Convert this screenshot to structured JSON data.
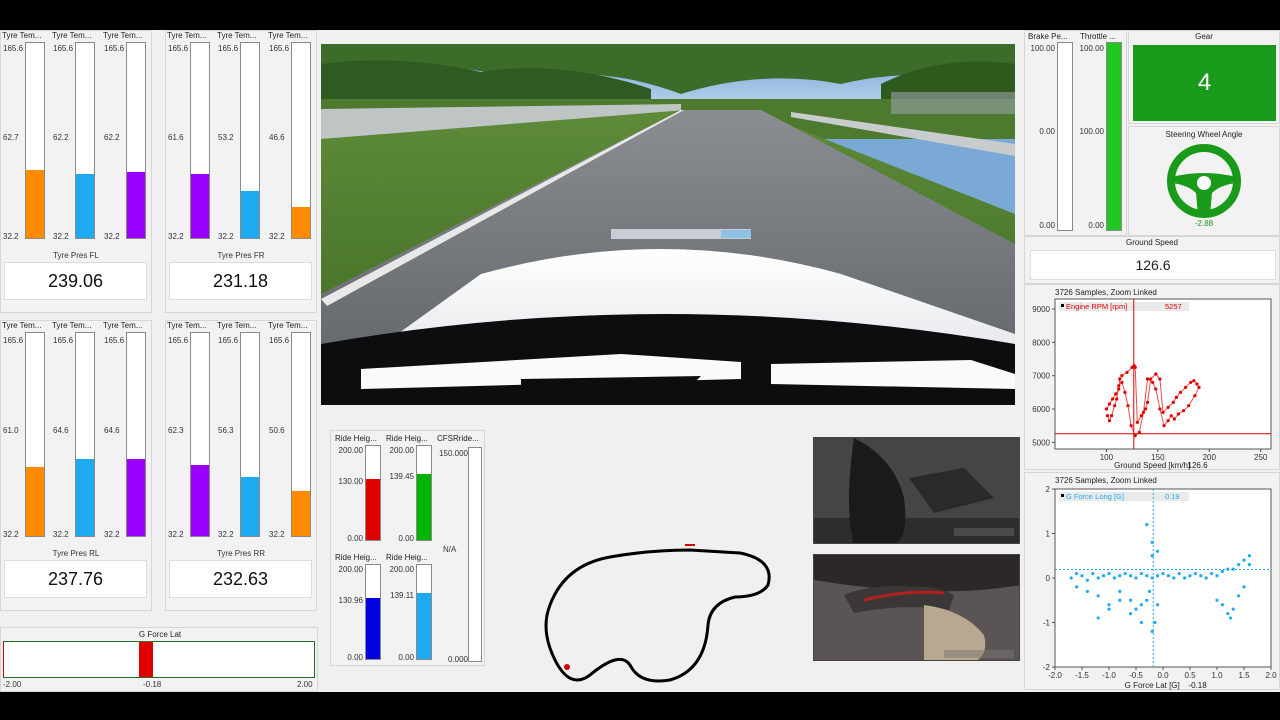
{
  "tyres": {
    "fl": {
      "labels": [
        "Tyre Tem...",
        "Tyre Tem...",
        "Tyre Tem..."
      ],
      "max": "165.6",
      "min": "32.2",
      "mids": [
        "62.7",
        "62.2",
        "62.2"
      ],
      "fills": [
        0.35,
        0.33,
        0.34
      ],
      "colors": [
        "#ff8c00",
        "#1eaaf1",
        "#9b00ff"
      ],
      "pres_label": "Tyre Pres FL",
      "pres_value": "239.06"
    },
    "fr": {
      "labels": [
        "Tyre Tem...",
        "Tyre Tem...",
        "Tyre Tem..."
      ],
      "max": "165.6",
      "min": "32.2",
      "mids": [
        "61.6",
        "53.2",
        "46.6"
      ],
      "fills": [
        0.33,
        0.24,
        0.16
      ],
      "colors": [
        "#9b00ff",
        "#1eaaf1",
        "#ff8c00"
      ],
      "pres_label": "Tyre Pres FR",
      "pres_value": "231.18"
    },
    "rl": {
      "labels": [
        "Tyre Tem...",
        "Tyre Tem...",
        "Tyre Tem..."
      ],
      "max": "165.6",
      "min": "32.2",
      "mids": [
        "61.0",
        "64.6",
        "64.6"
      ],
      "fills": [
        0.34,
        0.38,
        0.38
      ],
      "colors": [
        "#ff8c00",
        "#1eaaf1",
        "#9b00ff"
      ],
      "pres_label": "Tyre Pres RL",
      "pres_value": "237.76"
    },
    "rr": {
      "labels": [
        "Tyre Tem...",
        "Tyre Tem...",
        "Tyre Tem..."
      ],
      "max": "165.6",
      "min": "32.2",
      "mids": [
        "62.3",
        "56.3",
        "50.6"
      ],
      "fills": [
        0.35,
        0.29,
        0.22
      ],
      "colors": [
        "#9b00ff",
        "#1eaaf1",
        "#ff8c00"
      ],
      "pres_label": "Tyre Pres RR",
      "pres_value": "232.63"
    }
  },
  "glat": {
    "label": "G Force Lat",
    "min": "-2.00",
    "max": "2.00",
    "value": "-0.18",
    "fraction": 0.455,
    "color": "#e00000"
  },
  "ride": {
    "fl": {
      "label": "Ride Heig...",
      "max": "200.00",
      "min": "0.00",
      "value": "130.00",
      "fraction": 0.65,
      "color": "#e00000"
    },
    "fr": {
      "label": "Ride Heig...",
      "max": "200.00",
      "min": "0.00",
      "value": "139.45",
      "fraction": 0.7,
      "color": "#00b400"
    },
    "rl": {
      "label": "Ride Heig...",
      "max": "200.00",
      "min": "0.00",
      "value": "130.96",
      "fraction": 0.65,
      "color": "#0000e0"
    },
    "rr": {
      "label": "Ride Heig...",
      "max": "200.00",
      "min": "0.00",
      "value": "139.11",
      "fraction": 0.7,
      "color": "#1eaaf1"
    },
    "cfsr": {
      "label": "CFSRride...",
      "max": "150.000",
      "min": "0.000",
      "value": "N/A"
    }
  },
  "brake": {
    "label": "Brake Pe...",
    "max": "100.00",
    "mid": "0.00",
    "min": "0.00",
    "fraction": 0.0
  },
  "throttle": {
    "label": "Throttle ...",
    "max": "100.00",
    "mid": "100.00",
    "min": "0.00",
    "fraction": 1.0,
    "color": "#1ec81e"
  },
  "gear": {
    "label": "Gear",
    "value": "4",
    "color": "#1a9a1a"
  },
  "steering": {
    "label": "Steering Wheel Angle",
    "value": "-2.88",
    "color": "#1a9a1a"
  },
  "ground_speed": {
    "label": "Ground Speed",
    "value": "126.6"
  },
  "chart_data": [
    {
      "type": "scatter",
      "title": "3726 Samples, Zoom Linked",
      "legend": "Engine RPM [rpm]",
      "cursor_value": "5257",
      "xlabel": "Ground Speed [km/h]",
      "x_cursor_label": "126.6",
      "xlim": [
        50,
        260
      ],
      "ylim": [
        4800,
        9300
      ],
      "xticks": [
        "100",
        "150",
        "200",
        "250"
      ],
      "yticks": [
        "9000",
        "8000",
        "7000",
        "6000",
        "5000"
      ],
      "cursor": {
        "x": 126.6,
        "y": 5257
      },
      "color": "#e00000",
      "series": [
        {
          "x": [
            100,
            103,
            106,
            109,
            112,
            113,
            115,
            120,
            125,
            127,
            128,
            130,
            134,
            138,
            140,
            143,
            148,
            152,
            155,
            160,
            165,
            168,
            172,
            177,
            182,
            185,
            188,
            190,
            186,
            180,
            175,
            170,
            166,
            163,
            160,
            156,
            152,
            148,
            145,
            140,
            136,
            132,
            128,
            124,
            121,
            118,
            115,
            112,
            110,
            108,
            105,
            103,
            101
          ],
          "y": [
            6000,
            6150,
            6300,
            6450,
            6600,
            6900,
            7000,
            7100,
            7250,
            7300,
            7250,
            5600,
            5800,
            6000,
            6200,
            6900,
            7050,
            6900,
            5900,
            6050,
            6200,
            6350,
            6500,
            6650,
            6800,
            6850,
            6750,
            6650,
            6400,
            6100,
            5950,
            5850,
            5700,
            5800,
            5650,
            5500,
            6000,
            6600,
            6800,
            6900,
            5900,
            5300,
            5200,
            5500,
            6100,
            6500,
            6800,
            6700,
            6300,
            6100,
            5800,
            5650,
            5800
          ]
        }
      ]
    },
    {
      "type": "scatter",
      "title": "3726 Samples, Zoom Linked",
      "legend": "G Force Long [G]",
      "cursor_value": "0.19",
      "xlabel": "G Force Lat [G]",
      "x_cursor_label": "-0.18",
      "xlim": [
        -2,
        2
      ],
      "ylim": [
        -2,
        2
      ],
      "xticks": [
        "-2.0",
        "-1.5",
        "-1.0",
        "-0.5",
        "0.0",
        "0.5",
        "1.0",
        "1.5",
        "2.0"
      ],
      "yticks": [
        "2",
        "1",
        "0",
        "-1",
        "-2"
      ],
      "cursor": {
        "x": -0.18,
        "y": 0.19
      },
      "color": "#1eaaf1",
      "series": [
        {
          "x": [
            -1.7,
            -1.6,
            -1.5,
            -1.4,
            -1.3,
            -1.2,
            -1.1,
            -1.0,
            -0.9,
            -0.8,
            -0.7,
            -0.6,
            -0.5,
            -0.4,
            -0.3,
            -0.2,
            -0.1,
            0.0,
            0.1,
            0.2,
            0.3,
            0.4,
            0.5,
            0.6,
            0.7,
            0.8,
            0.9,
            1.0,
            1.1,
            1.2,
            1.3,
            1.4,
            1.5,
            1.6,
            -1.6,
            -1.4,
            -1.2,
            -1.0,
            -0.8,
            -0.6,
            -0.5,
            -0.4,
            -0.3,
            -0.25,
            -0.2,
            -0.15,
            -0.1,
            1.0,
            1.1,
            1.2,
            1.25,
            1.3,
            1.4,
            1.5,
            1.6,
            -1.2,
            -1.0,
            -0.8,
            -0.6,
            -0.4,
            -0.2,
            -0.3,
            -0.2,
            -0.1
          ],
          "y": [
            0.0,
            0.1,
            0.05,
            -0.05,
            0.1,
            0.0,
            0.05,
            0.1,
            0.0,
            0.05,
            0.1,
            0.05,
            0.0,
            0.1,
            0.05,
            0.0,
            0.05,
            0.1,
            0.05,
            0.0,
            0.1,
            0.0,
            0.05,
            0.1,
            0.05,
            0.0,
            0.1,
            0.05,
            0.15,
            0.2,
            0.2,
            0.3,
            0.4,
            0.5,
            -0.2,
            -0.3,
            -0.4,
            -0.6,
            -0.5,
            -0.8,
            -0.7,
            -1.0,
            -0.5,
            -0.3,
            -1.2,
            -1.0,
            -0.6,
            -0.5,
            -0.6,
            -0.8,
            -0.9,
            -0.7,
            -0.4,
            -0.2,
            0.3,
            -0.9,
            -0.7,
            -0.3,
            -0.5,
            -0.6,
            0.5,
            1.2,
            0.8,
            0.6
          ]
        }
      ]
    }
  ]
}
